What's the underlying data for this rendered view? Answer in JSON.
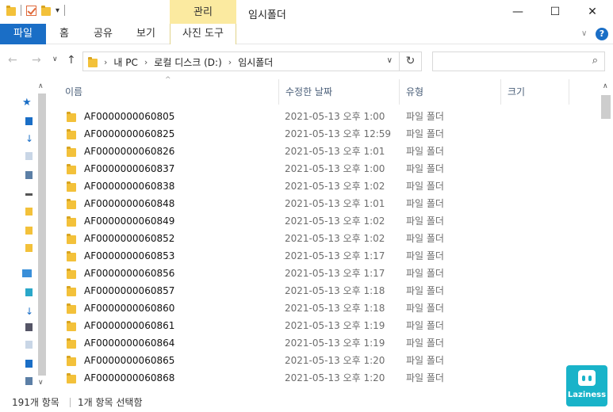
{
  "window": {
    "title": "임시폴더",
    "context_tab": "관리",
    "minimize": "—",
    "maximize": "☐",
    "close": "✕"
  },
  "ribbon": {
    "tabs": [
      "파일",
      "홈",
      "공유",
      "보기"
    ],
    "context_tab": "사진 도구",
    "help": "?"
  },
  "address": {
    "crumbs": [
      "내 PC",
      "로컬 디스크 (D:)",
      "임시폴더"
    ],
    "search_placeholder": ""
  },
  "columns": {
    "name": "이름",
    "date": "수정한 날짜",
    "type": "유형",
    "size": "크기"
  },
  "files": [
    {
      "name": "AF0000000060805",
      "date": "2021-05-13 오후 1:00",
      "type": "파일 폴더"
    },
    {
      "name": "AF0000000060825",
      "date": "2021-05-13 오후 12:59",
      "type": "파일 폴더"
    },
    {
      "name": "AF0000000060826",
      "date": "2021-05-13 오후 1:01",
      "type": "파일 폴더"
    },
    {
      "name": "AF0000000060837",
      "date": "2021-05-13 오후 1:00",
      "type": "파일 폴더"
    },
    {
      "name": "AF0000000060838",
      "date": "2021-05-13 오후 1:02",
      "type": "파일 폴더"
    },
    {
      "name": "AF0000000060848",
      "date": "2021-05-13 오후 1:01",
      "type": "파일 폴더"
    },
    {
      "name": "AF0000000060849",
      "date": "2021-05-13 오후 1:02",
      "type": "파일 폴더"
    },
    {
      "name": "AF0000000060852",
      "date": "2021-05-13 오후 1:02",
      "type": "파일 폴더"
    },
    {
      "name": "AF0000000060853",
      "date": "2021-05-13 오후 1:17",
      "type": "파일 폴더"
    },
    {
      "name": "AF0000000060856",
      "date": "2021-05-13 오후 1:17",
      "type": "파일 폴더"
    },
    {
      "name": "AF0000000060857",
      "date": "2021-05-13 오후 1:18",
      "type": "파일 폴더"
    },
    {
      "name": "AF0000000060860",
      "date": "2021-05-13 오후 1:18",
      "type": "파일 폴더"
    },
    {
      "name": "AF0000000060861",
      "date": "2021-05-13 오후 1:19",
      "type": "파일 폴더"
    },
    {
      "name": "AF0000000060864",
      "date": "2021-05-13 오후 1:19",
      "type": "파일 폴더"
    },
    {
      "name": "AF0000000060865",
      "date": "2021-05-13 오후 1:20",
      "type": "파일 폴더"
    },
    {
      "name": "AF0000000060868",
      "date": "2021-05-13 오후 1:20",
      "type": "파일 폴더"
    }
  ],
  "status": {
    "item_count": "191개 항목",
    "selected": "1개 항목 선택함"
  },
  "badge": {
    "label": "Laziness"
  },
  "colors": {
    "file_tab": "#1a6ec6",
    "context_tab": "#fbeaa0",
    "folder": "#f3c13a",
    "badge": "#19b3c9"
  }
}
